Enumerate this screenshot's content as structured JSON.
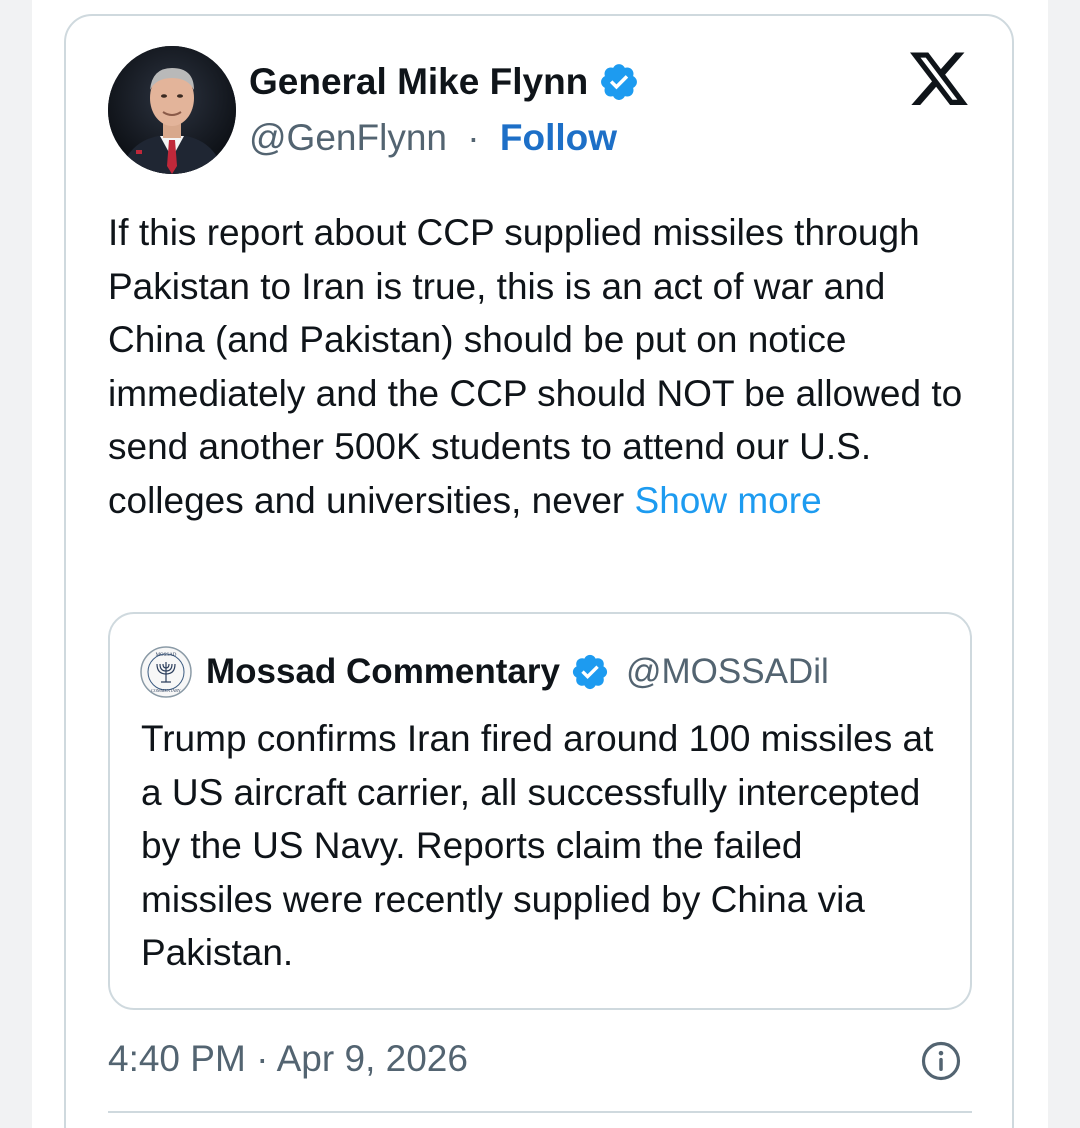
{
  "tweet": {
    "author": {
      "name": "General Mike Flynn",
      "handle": "@GenFlynn",
      "separator": "·",
      "follow_label": "Follow",
      "verified": true
    },
    "text": "If this report about CCP supplied missiles through Pakistan to Iran is true, this is an act of war and China (and Pakistan) should be put on notice immediately and the CCP should NOT be allowed to send another 500K students to attend our U.S. colleges and universities, never",
    "show_more_label": "Show more",
    "quoted": {
      "name": "Mossad Commentary",
      "handle": "@MOSSADil",
      "verified": true,
      "text": "Trump confirms Iran fired around 100 missiles at a US aircraft carrier, all successfully intercepted by the US Navy. Reports claim the failed missiles were recently supplied by China via Pakistan.",
      "avatar_text_top": "MOSSAD",
      "avatar_text_bottom": "COMMENTARY"
    },
    "timestamp": "4:40 PM · Apr 9, 2026"
  },
  "icons": {
    "platform": "x-logo-icon",
    "verified": "verified-badge-icon",
    "info": "info-icon"
  },
  "colors": {
    "link": "#1d6fc7",
    "show_more": "#1d9bf0",
    "verified": "#1d9bf0",
    "text": "#0f1419",
    "secondary": "#536471",
    "border": "#cfd9de"
  }
}
